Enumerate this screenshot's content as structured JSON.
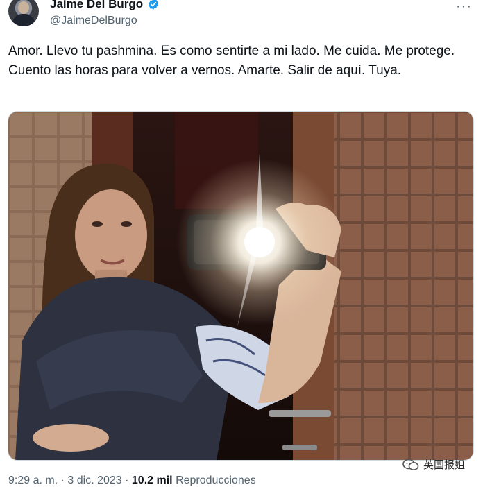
{
  "author": {
    "display_name": "Jaime Del Burgo",
    "handle": "@JaimeDelBurgo",
    "verified_icon": "verified-badge-icon",
    "more_icon": "more-options-icon"
  },
  "tweet": {
    "text": "Amor. Llevo tu pashmina. Es como sentirte a mi lado. Me cuida. Me protege. Cuento las horas para volver a vernos. Amarte. Salir de aquí. Tuya."
  },
  "meta": {
    "time": "9:29 a. m.",
    "separator": "·",
    "date": "3 dic. 2023",
    "views_count": "10.2 mil",
    "views_label": "Reproducciones"
  },
  "watermark": {
    "text": "英国报姐"
  },
  "colors": {
    "text": "#0f1419",
    "secondary": "#536471",
    "verified": "#1d9bf0"
  }
}
